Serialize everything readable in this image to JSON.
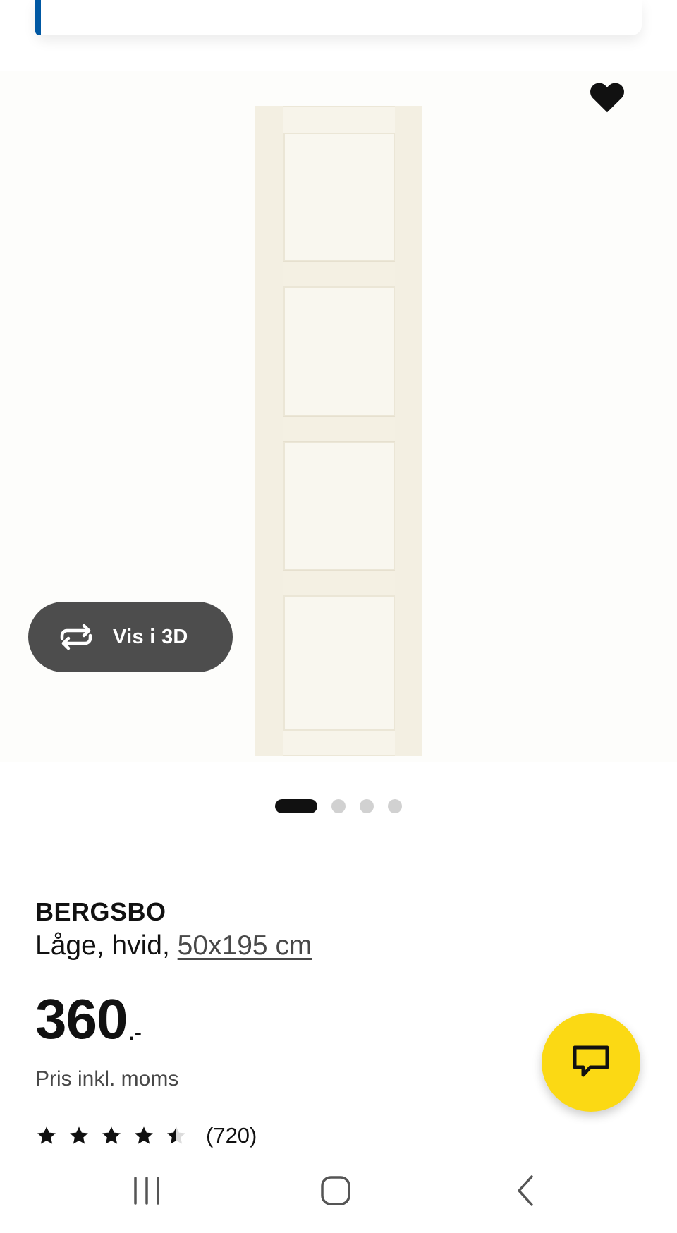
{
  "product": {
    "name": "BERGSBO",
    "description_prefix": "Låge, hvid, ",
    "size_link": "50x195 cm",
    "price_integer": "360",
    "price_suffix": ".-",
    "price_note": "Pris inkl. moms",
    "rating": 4.5,
    "rating_max": 5,
    "review_count": "(720)"
  },
  "gallery": {
    "view_3d_label": "Vis i 3D",
    "image_count": 4,
    "active_index": 0
  },
  "icons": {
    "favorite": "heart-icon",
    "view_3d": "rotate-icon",
    "chat": "chat-bubble-icon",
    "nav_recent": "recent-apps-icon",
    "nav_home": "home-icon",
    "nav_back": "back-icon"
  },
  "colors": {
    "brand_blue": "#0058a3",
    "chat_yellow": "#fbd914",
    "button_dark": "#4d4d4d"
  }
}
